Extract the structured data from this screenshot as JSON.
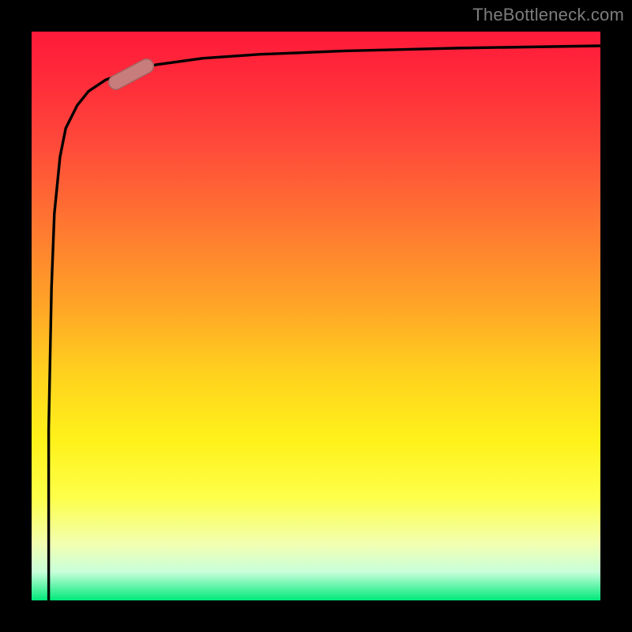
{
  "attribution": "TheBottleneck.com",
  "chart_data": {
    "type": "area",
    "title": "",
    "xlabel": "",
    "ylabel": "",
    "xlim": [
      0,
      100
    ],
    "ylim": [
      0,
      100
    ],
    "gradient_stops": [
      {
        "pos": 0,
        "color": "#ff1a3a"
      },
      {
        "pos": 20,
        "color": "#ff4a3a"
      },
      {
        "pos": 48,
        "color": "#ffa427"
      },
      {
        "pos": 72,
        "color": "#fff21a"
      },
      {
        "pos": 100,
        "color": "#00e97a"
      }
    ],
    "series": [
      {
        "name": "curve",
        "x": [
          3,
          3,
          3.5,
          4,
          5,
          6,
          8,
          10,
          13,
          17,
          22,
          30,
          40,
          55,
          75,
          100
        ],
        "y": [
          0,
          30,
          55,
          68,
          78,
          83,
          87,
          89.5,
          91.5,
          93,
          94.2,
          95.3,
          96,
          96.6,
          97.1,
          97.5
        ]
      }
    ],
    "marker": {
      "x_center": 17.5,
      "y_center": 92.5,
      "angle_deg": -28
    }
  }
}
